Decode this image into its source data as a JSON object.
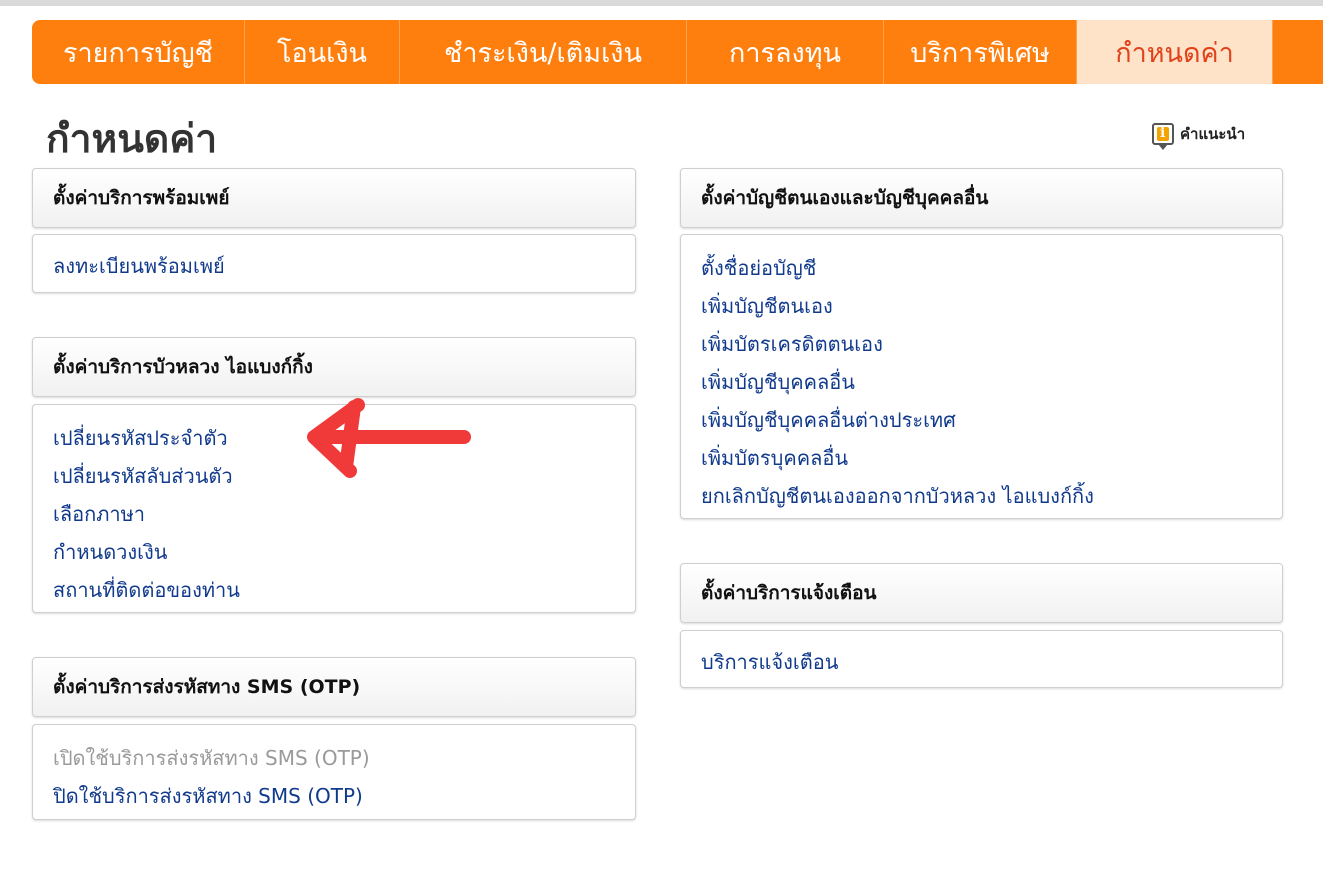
{
  "nav": {
    "tabs": [
      {
        "label": "รายการบัญชี",
        "active": false
      },
      {
        "label": "โอนเงิน",
        "active": false
      },
      {
        "label": "ชำระเงิน/เติมเงิน",
        "active": false
      },
      {
        "label": "การลงทุน",
        "active": false
      },
      {
        "label": "บริการพิเศษ",
        "active": false
      },
      {
        "label": "กำหนดค่า",
        "active": true
      }
    ]
  },
  "page": {
    "title": "กำหนดค่า",
    "help_label": "คำแนะนำ"
  },
  "sections": {
    "promptpay": {
      "title": "ตั้งค่าบริการพร้อมเพย์",
      "links": [
        "ลงทะเบียนพร้อมเพย์"
      ]
    },
    "ibanking": {
      "title": "ตั้งค่าบริการบัวหลวง ไอแบงก์กิ้ง",
      "links": [
        "เปลี่ยนรหัสประจำตัว",
        "เปลี่ยนรหัสลับส่วนตัว",
        "เลือกภาษา",
        "กำหนดวงเงิน",
        "สถานที่ติดต่อของท่าน"
      ]
    },
    "otp": {
      "title": "ตั้งค่าบริการส่งรหัสทาง SMS (OTP)",
      "links": [
        "เปิดใช้บริการส่งรหัสทาง SMS (OTP)",
        "ปิดใช้บริการส่งรหัสทาง SMS (OTP)"
      ]
    },
    "accounts": {
      "title": "ตั้งค่าบัญชีตนเองและบัญชีบุคคลอื่น",
      "links": [
        "ตั้งชื่อย่อบัญชี",
        "เพิ่มบัญชีตนเอง",
        "เพิ่มบัตรเครดิตตนเอง",
        "เพิ่มบัญชีบุคคลอื่น",
        "เพิ่มบัญชีบุคคลอื่นต่างประเทศ",
        "เพิ่มบัตรบุคคลอื่น",
        "ยกเลิกบัญชีตนเองออกจากบัวหลวง ไอแบงก์กิ้ง"
      ]
    },
    "alerts": {
      "title": "ตั้งค่าบริการแจ้งเตือน",
      "links": [
        "บริการแจ้งเตือน"
      ]
    }
  },
  "colors": {
    "nav_bg": "#ff7f0e",
    "nav_active_bg": "#ffe3c8",
    "nav_active_text": "#e0421a",
    "link": "#113a8c",
    "annotation_arrow": "#f03a3a"
  }
}
